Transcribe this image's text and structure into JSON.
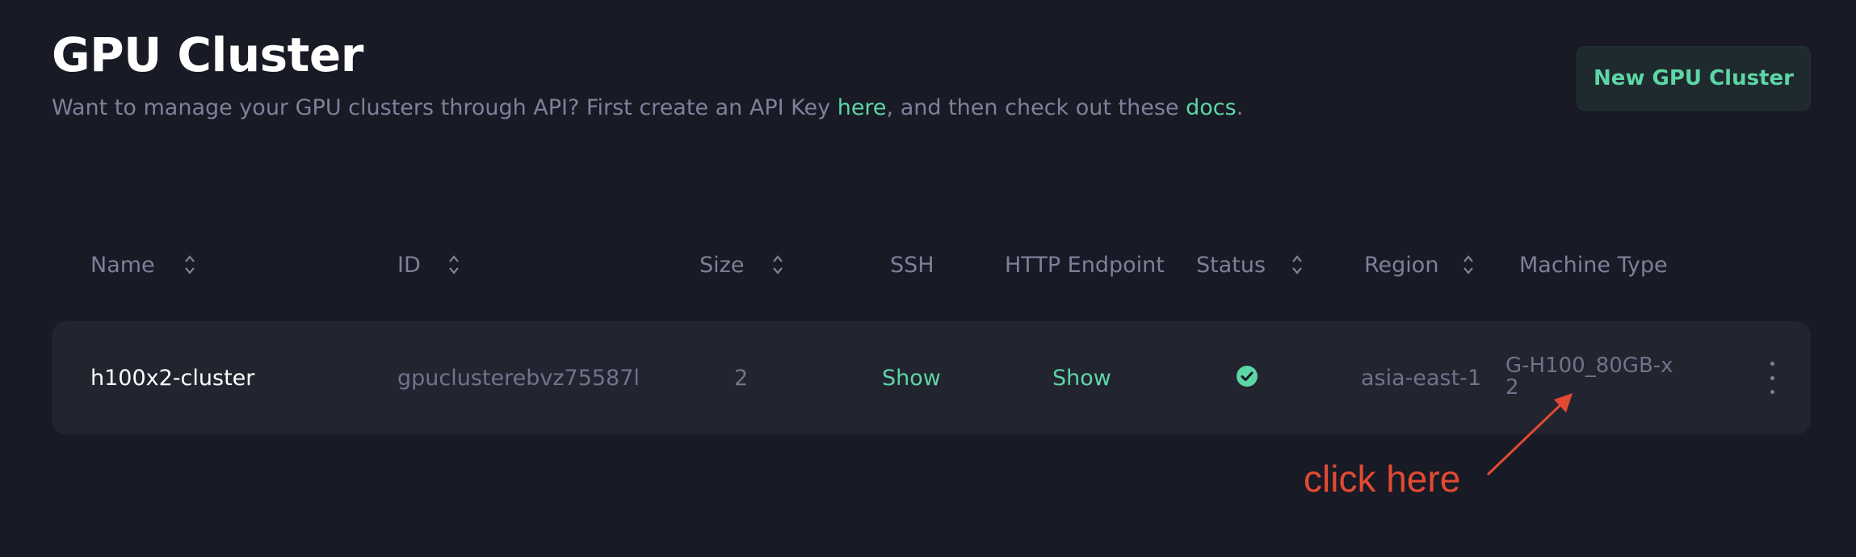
{
  "header": {
    "title": "GPU Cluster",
    "subtitle_pre": "Want to manage your GPU clusters through API? First create an API Key ",
    "subtitle_link1": "here",
    "subtitle_mid": ", and then check out these ",
    "subtitle_link2": "docs",
    "subtitle_post": ".",
    "new_button": "New GPU Cluster"
  },
  "table": {
    "columns": {
      "name": "Name",
      "id": "ID",
      "size": "Size",
      "ssh": "SSH",
      "http": "HTTP Endpoint",
      "status": "Status",
      "region": "Region",
      "machine": "Machine Type"
    },
    "rows": [
      {
        "name": "h100x2-cluster",
        "id": "gpuclusterebvz75587l",
        "size": "2",
        "ssh": "Show",
        "http": "Show",
        "status": "active-check-icon",
        "region": "asia-east-1",
        "machine": "G-H100_80GB-x2"
      }
    ]
  },
  "annotation": {
    "text": "click here",
    "color": "#e24a33"
  },
  "colors": {
    "background": "#181a25",
    "accent": "#5dd6a5",
    "row_background": "#22242f"
  }
}
